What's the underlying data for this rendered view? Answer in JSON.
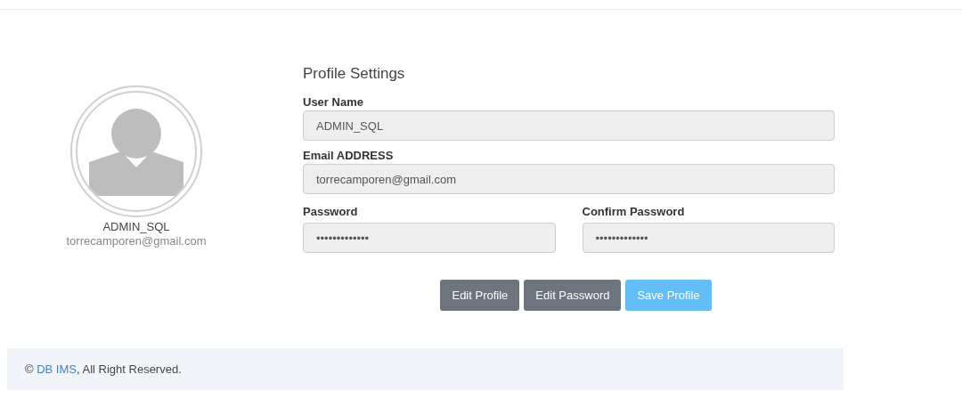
{
  "profile_card": {
    "name": "ADMIN_SQL",
    "email": "torrecamporen@gmail.com"
  },
  "form": {
    "title": "Profile Settings",
    "fields": [
      {
        "label": "User Name",
        "value": "ADMIN_SQL",
        "disabled": true
      },
      {
        "label": "Email ADDRESS",
        "value": "torrecamporen@gmail.com",
        "disabled": true
      }
    ],
    "password_fields": [
      {
        "label": "Password",
        "value": "•••••••••••••",
        "disabled": true
      },
      {
        "label": "Confirm Password",
        "value": "•••••••••••••",
        "disabled": true
      }
    ],
    "buttons": [
      {
        "label": "Edit Profile",
        "kind": "secondary",
        "disabled": false
      },
      {
        "label": "Edit Password",
        "kind": "secondary",
        "disabled": false
      },
      {
        "label": "Save Profile",
        "kind": "primary",
        "disabled": true
      }
    ]
  },
  "footer": {
    "prefix": "© ",
    "link": "DB IMS",
    "suffix": ", All Right Reserved."
  }
}
